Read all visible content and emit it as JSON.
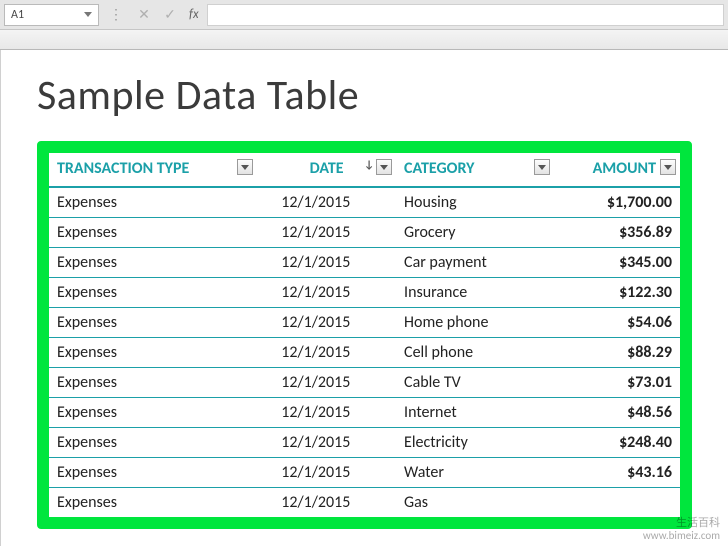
{
  "formula_bar": {
    "name_box": "A1",
    "fx_label": "fx"
  },
  "page": {
    "title": "Sample Data Table"
  },
  "table": {
    "headers": {
      "transaction_type": "TRANSACTION TYPE",
      "date": "DATE",
      "category": "CATEGORY",
      "amount": "AMOUNT"
    },
    "rows": [
      {
        "type": "Expenses",
        "date": "12/1/2015",
        "category": "Housing",
        "amount": "$1,700.00"
      },
      {
        "type": "Expenses",
        "date": "12/1/2015",
        "category": "Grocery",
        "amount": "$356.89"
      },
      {
        "type": "Expenses",
        "date": "12/1/2015",
        "category": "Car payment",
        "amount": "$345.00"
      },
      {
        "type": "Expenses",
        "date": "12/1/2015",
        "category": "Insurance",
        "amount": "$122.30"
      },
      {
        "type": "Expenses",
        "date": "12/1/2015",
        "category": "Home phone",
        "amount": "$54.06"
      },
      {
        "type": "Expenses",
        "date": "12/1/2015",
        "category": "Cell phone",
        "amount": "$88.29"
      },
      {
        "type": "Expenses",
        "date": "12/1/2015",
        "category": "Cable TV",
        "amount": "$73.01"
      },
      {
        "type": "Expenses",
        "date": "12/1/2015",
        "category": "Internet",
        "amount": "$48.56"
      },
      {
        "type": "Expenses",
        "date": "12/1/2015",
        "category": "Electricity",
        "amount": "$248.40"
      },
      {
        "type": "Expenses",
        "date": "12/1/2015",
        "category": "Water",
        "amount": "$43.16"
      },
      {
        "type": "Expenses",
        "date": "12/1/2015",
        "category": "Gas",
        "amount": ""
      }
    ]
  },
  "watermark": {
    "line1": "生活百科",
    "line2": "www.bimeiz.com"
  }
}
